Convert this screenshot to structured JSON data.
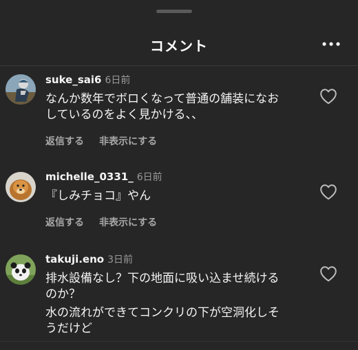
{
  "header": {
    "title": "コメント",
    "more_icon": "more-horizontal-icon"
  },
  "comments": [
    {
      "username": "suke_sai6",
      "timestamp": "6日前",
      "lines": [
        "なんか数年でボロくなって普通の舗装になお",
        "しているのをよく見かける、、"
      ],
      "reply_label": "返信する",
      "hide_label": "非表示にする",
      "like_icon": "heart-outline-icon",
      "avatar_icon": "cyclist-avatar-icon"
    },
    {
      "username": "michelle_0331_",
      "timestamp": "6日前",
      "lines": [
        "『しみチョコ』やん"
      ],
      "reply_label": "返信する",
      "hide_label": "非表示にする",
      "like_icon": "heart-outline-icon",
      "avatar_icon": "dog-avatar-icon"
    },
    {
      "username": "takuji.eno",
      "timestamp": "3日前",
      "paragraphs": [
        [
          "排水設備なし？下の地面に吸い込ませ続ける",
          "のか？"
        ],
        [
          "水の流れができてコンクリの下が空洞化しそ",
          "うだけど"
        ]
      ],
      "like_icon": "heart-outline-icon",
      "avatar_icon": "panda-avatar-icon"
    }
  ],
  "colors": {
    "background": "#262626",
    "text": "#f5f5f5",
    "muted": "#9a9a9a"
  }
}
